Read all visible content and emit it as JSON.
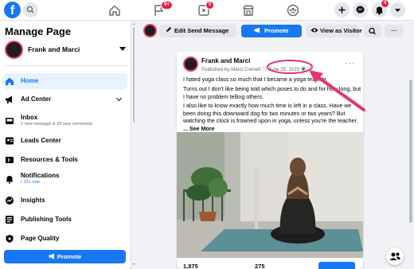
{
  "topbar": {
    "logo": "f",
    "badges": {
      "flag": "9+",
      "video": "5",
      "notifications": "4"
    },
    "icons": [
      "search-icon",
      "home-icon",
      "flag-icon",
      "video-icon",
      "marketplace-icon",
      "groups-icon",
      "plus-icon",
      "messenger-icon",
      "bell-icon",
      "caret-down-icon"
    ]
  },
  "sidebar": {
    "title": "Manage Page",
    "page_name": "Frank and Marci",
    "items": [
      {
        "label": "Home",
        "sub": "",
        "icon": "home-icon"
      },
      {
        "label": "Ad Center",
        "sub": "",
        "icon": "ad-center-icon"
      },
      {
        "label": "Inbox",
        "sub": "1 new message & 33 new comments",
        "icon": "inbox-icon"
      },
      {
        "label": "Leads Center",
        "sub": "",
        "icon": "leads-icon"
      },
      {
        "label": "Resources & Tools",
        "sub": "",
        "icon": "resources-icon"
      },
      {
        "label": "Notifications",
        "sub": "151 new",
        "icon": "bell-icon"
      },
      {
        "label": "Insights",
        "sub": "",
        "icon": "insights-icon"
      },
      {
        "label": "Publishing Tools",
        "sub": "",
        "icon": "publishing-icon"
      },
      {
        "label": "Page Quality",
        "sub": "",
        "icon": "shield-icon"
      }
    ],
    "promote": "Promote"
  },
  "toolbar": {
    "edit_send": "Edit Send Message",
    "promote": "Promote",
    "view_as": "View as Visitor",
    "more": "···"
  },
  "post": {
    "author": "Frank and Marci",
    "published_by": "Published by",
    "publisher": "Marci Cornett",
    "date": "June 25, 2020",
    "more": "···",
    "para1": "I hated yoga class so much that I became a yoga teacher.",
    "para2": "Turns out I don't like being told which poses to do and for how long, but I have no problem telling others.",
    "para3": "I also like to know exactly how much time is left in a class. Have we been doing this downward dog for two minutes or two years? But watching the clock is frowned upon in yoga, unless you're the teacher.",
    "see_more": "... See More",
    "stat1": "1,875",
    "stat2": "275"
  },
  "colors": {
    "brand": "#1877f2",
    "annotation": "#e6336b",
    "badge": "#e41e3f"
  }
}
